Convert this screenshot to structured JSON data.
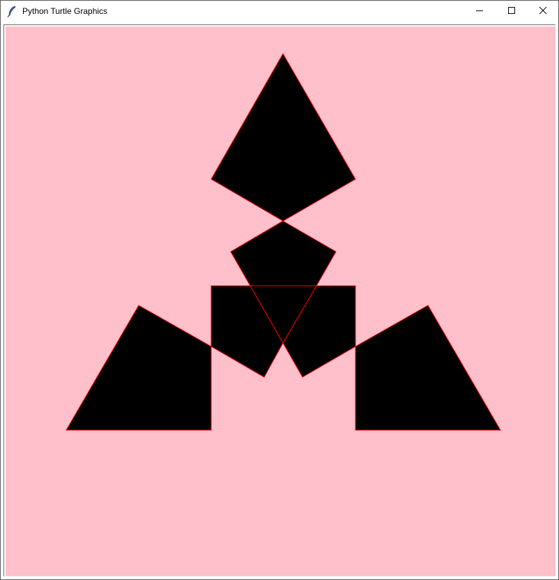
{
  "window": {
    "title": "Python Turtle Graphics",
    "icon": "feather-icon"
  },
  "controls": {
    "minimize_icon": "minimize-icon",
    "maximize_icon": "maximize-icon",
    "close_icon": "close-icon"
  },
  "canvas": {
    "background_color": "#ffc0cb",
    "fill_color": "#000000",
    "pen_color": "#ff0000"
  }
}
